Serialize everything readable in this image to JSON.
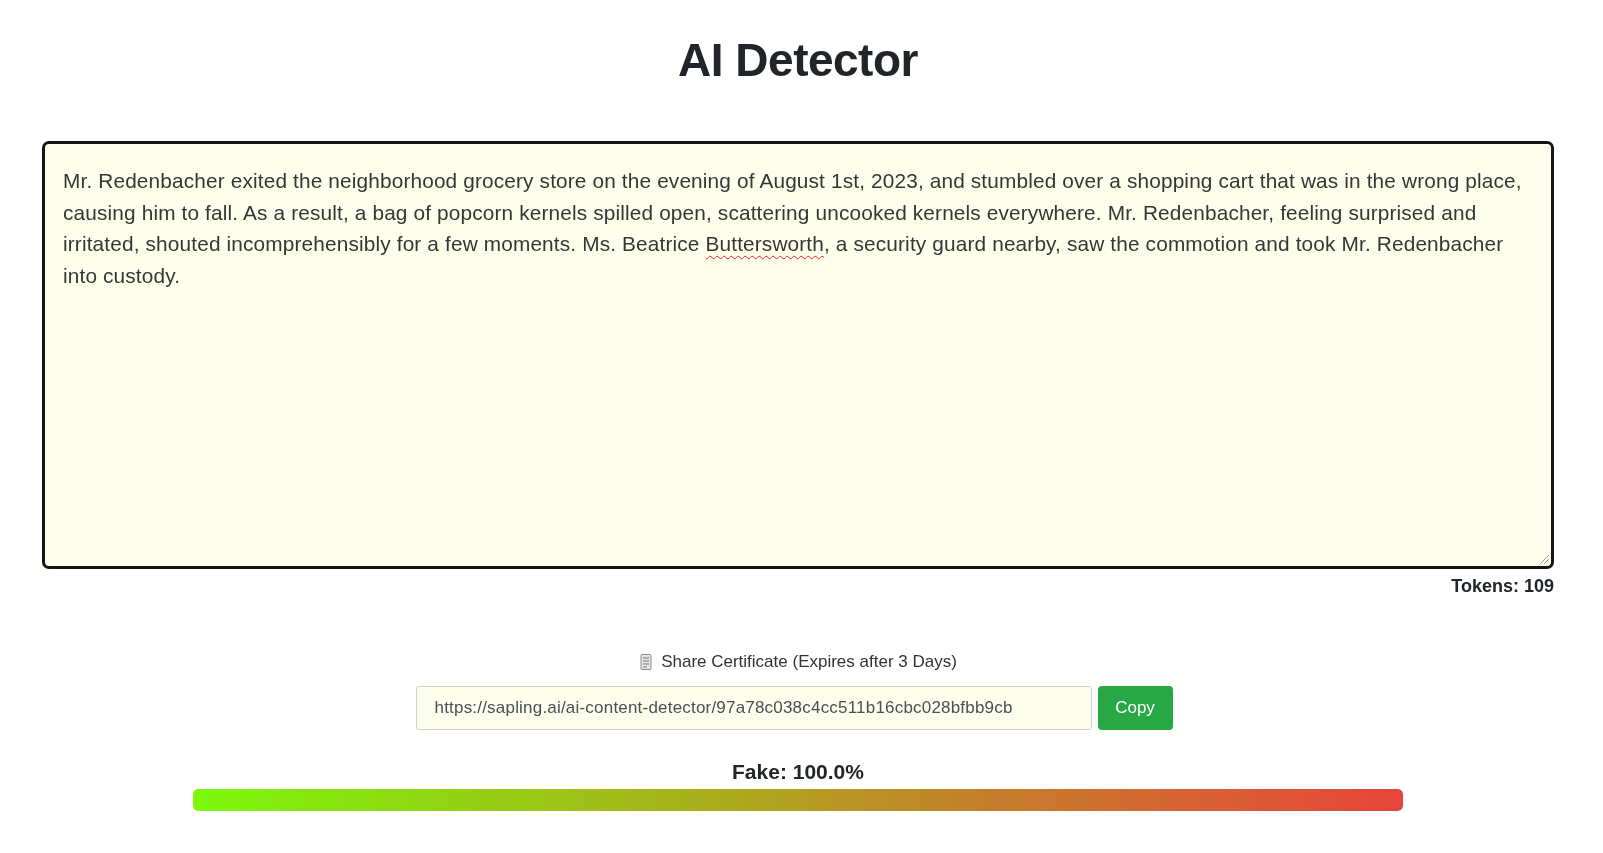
{
  "title": "AI Detector",
  "editor": {
    "segments": [
      {
        "text": "Mr. Redenbacher exited the neighborhood grocery store on the evening of August 1st, 2023, and stumbled over a shopping cart that was in the wrong place, causing him to fall. As a result, a bag of popcorn kernels spilled open, scattering uncooked kernels everywhere. Mr. Redenbacher, feeling surprised and irritated, shouted incomprehensibly for a few moments. Ms. Beatrice ",
        "misspelled": false
      },
      {
        "text": "Buttersworth",
        "misspelled": true
      },
      {
        "text": ", a security guard nearby, saw the commotion and took Mr. Redenbacher into custody.",
        "misspelled": false
      }
    ],
    "tokens": "Tokens: 109"
  },
  "share": {
    "label": "Share Certificate (Expires after 3 Days)",
    "url": "https://sapling.ai/ai-content-detector/97a78c038c4cc511b16cbc028bfbb9cb",
    "copy_button": "Copy"
  },
  "score": {
    "label": "Fake: 100.0%",
    "level": 1.0
  }
}
